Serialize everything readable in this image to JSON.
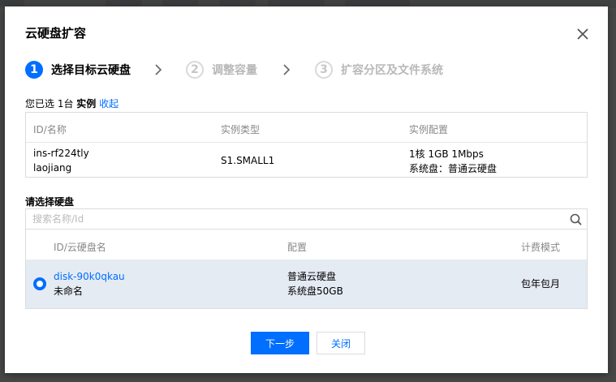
{
  "dialog": {
    "title": "云硬盘扩容"
  },
  "steps": [
    {
      "number": "1",
      "label": "选择目标云硬盘"
    },
    {
      "number": "2",
      "label": "调整容量"
    },
    {
      "number": "3",
      "label": "扩容分区及文件系统"
    }
  ],
  "selection_summary": {
    "prefix": "您已选 1台",
    "noun": "实例",
    "collapse_link": "收起"
  },
  "instance_table": {
    "headers": [
      "ID/名称",
      "实例类型",
      "实例配置"
    ],
    "row": {
      "id": "ins-rf224tly",
      "name": "laojiang",
      "type": "S1.SMALL1",
      "config_line1": "1核 1GB 1Mbps",
      "config_line2": "系统盘：普通云硬盘"
    }
  },
  "disk_section": {
    "label": "请选择硬盘",
    "search_placeholder": "搜索名称/Id",
    "headers": [
      "ID/云硬盘名",
      "配置",
      "计费模式"
    ],
    "row": {
      "id": "disk-90k0qkau",
      "name": "未命名",
      "config_line1": "普通云硬盘",
      "config_line2": "系统盘50GB",
      "billing": "包年包月",
      "selected": true
    }
  },
  "buttons": {
    "next": "下一步",
    "close": "关闭"
  },
  "icons": {
    "close": "close-icon",
    "search": "search-icon",
    "chevron": "chevron-right-icon"
  },
  "colors": {
    "accent": "#006eff",
    "selected_row": "#e5ebf3",
    "inactive_step": "#b8b8b8"
  }
}
